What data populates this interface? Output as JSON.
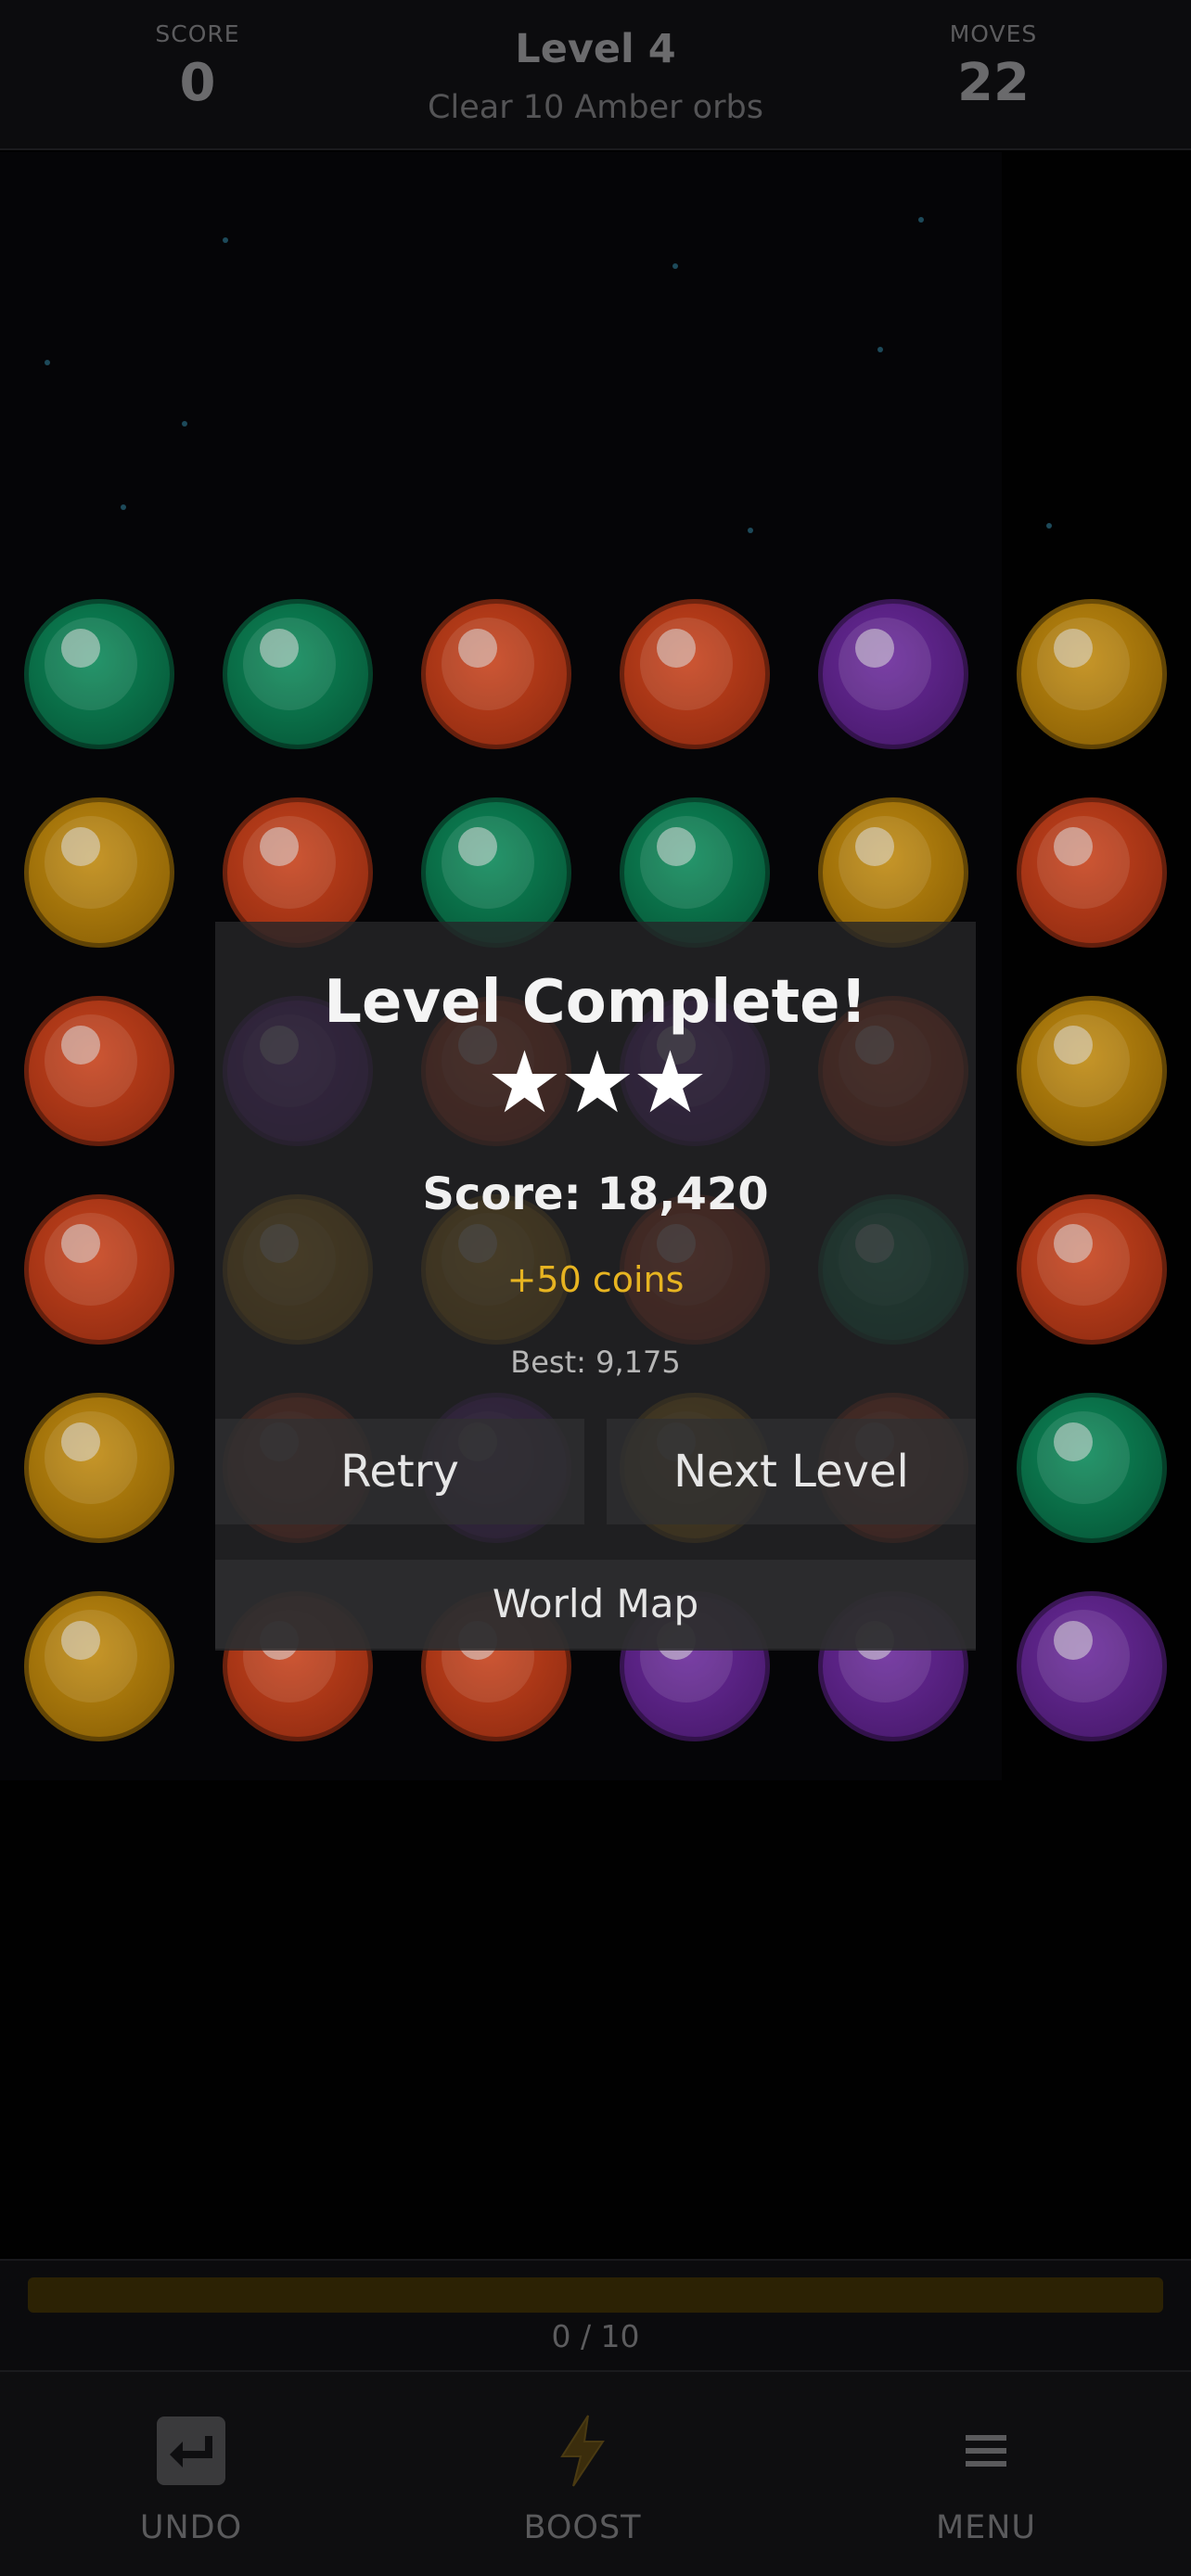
{
  "hud": {
    "score_label": "SCORE",
    "score_value": "0",
    "level_title": "Level 4",
    "goal_text": "Clear 10 Amber orbs",
    "moves_label": "MOVES",
    "moves_value": "22"
  },
  "board": {
    "rows": [
      [
        "green",
        "green",
        "red",
        "red",
        "purple",
        "amber"
      ],
      [
        "amber",
        "red",
        "green",
        "green",
        "amber",
        "red"
      ],
      [
        "red",
        "purple",
        "red",
        "purple",
        "red",
        "amber"
      ],
      [
        "red",
        "amber",
        "amber",
        "red",
        "green",
        "red"
      ],
      [
        "amber",
        "red",
        "purple",
        "amber",
        "red",
        "green"
      ],
      [
        "amber",
        "red",
        "red",
        "purple",
        "purple",
        "purple"
      ]
    ]
  },
  "modal": {
    "title": "Level Complete!",
    "stars": "★★★",
    "stars_earned": 3,
    "score_text": "Score: 18,420",
    "coins_text": "+50 coins",
    "best_text": "Best: 9,175",
    "retry_label": "Retry",
    "next_label": "Next Level",
    "map_label": "World Map"
  },
  "progress": {
    "text": "0 / 10",
    "fraction": 0
  },
  "bottom_bar": {
    "undo_label": "UNDO",
    "undo_icon": "undo-icon",
    "boost_label": "BOOST",
    "boost_icon": "lightning-icon",
    "menu_label": "MENU",
    "menu_icon": "hamburger-menu-icon"
  },
  "colors": {
    "accent_gold": "#e7b421",
    "orb_green": "#0d8a5a",
    "orb_red": "#c8431c",
    "orb_purple": "#6b2a9c",
    "orb_amber": "#c08a10"
  }
}
